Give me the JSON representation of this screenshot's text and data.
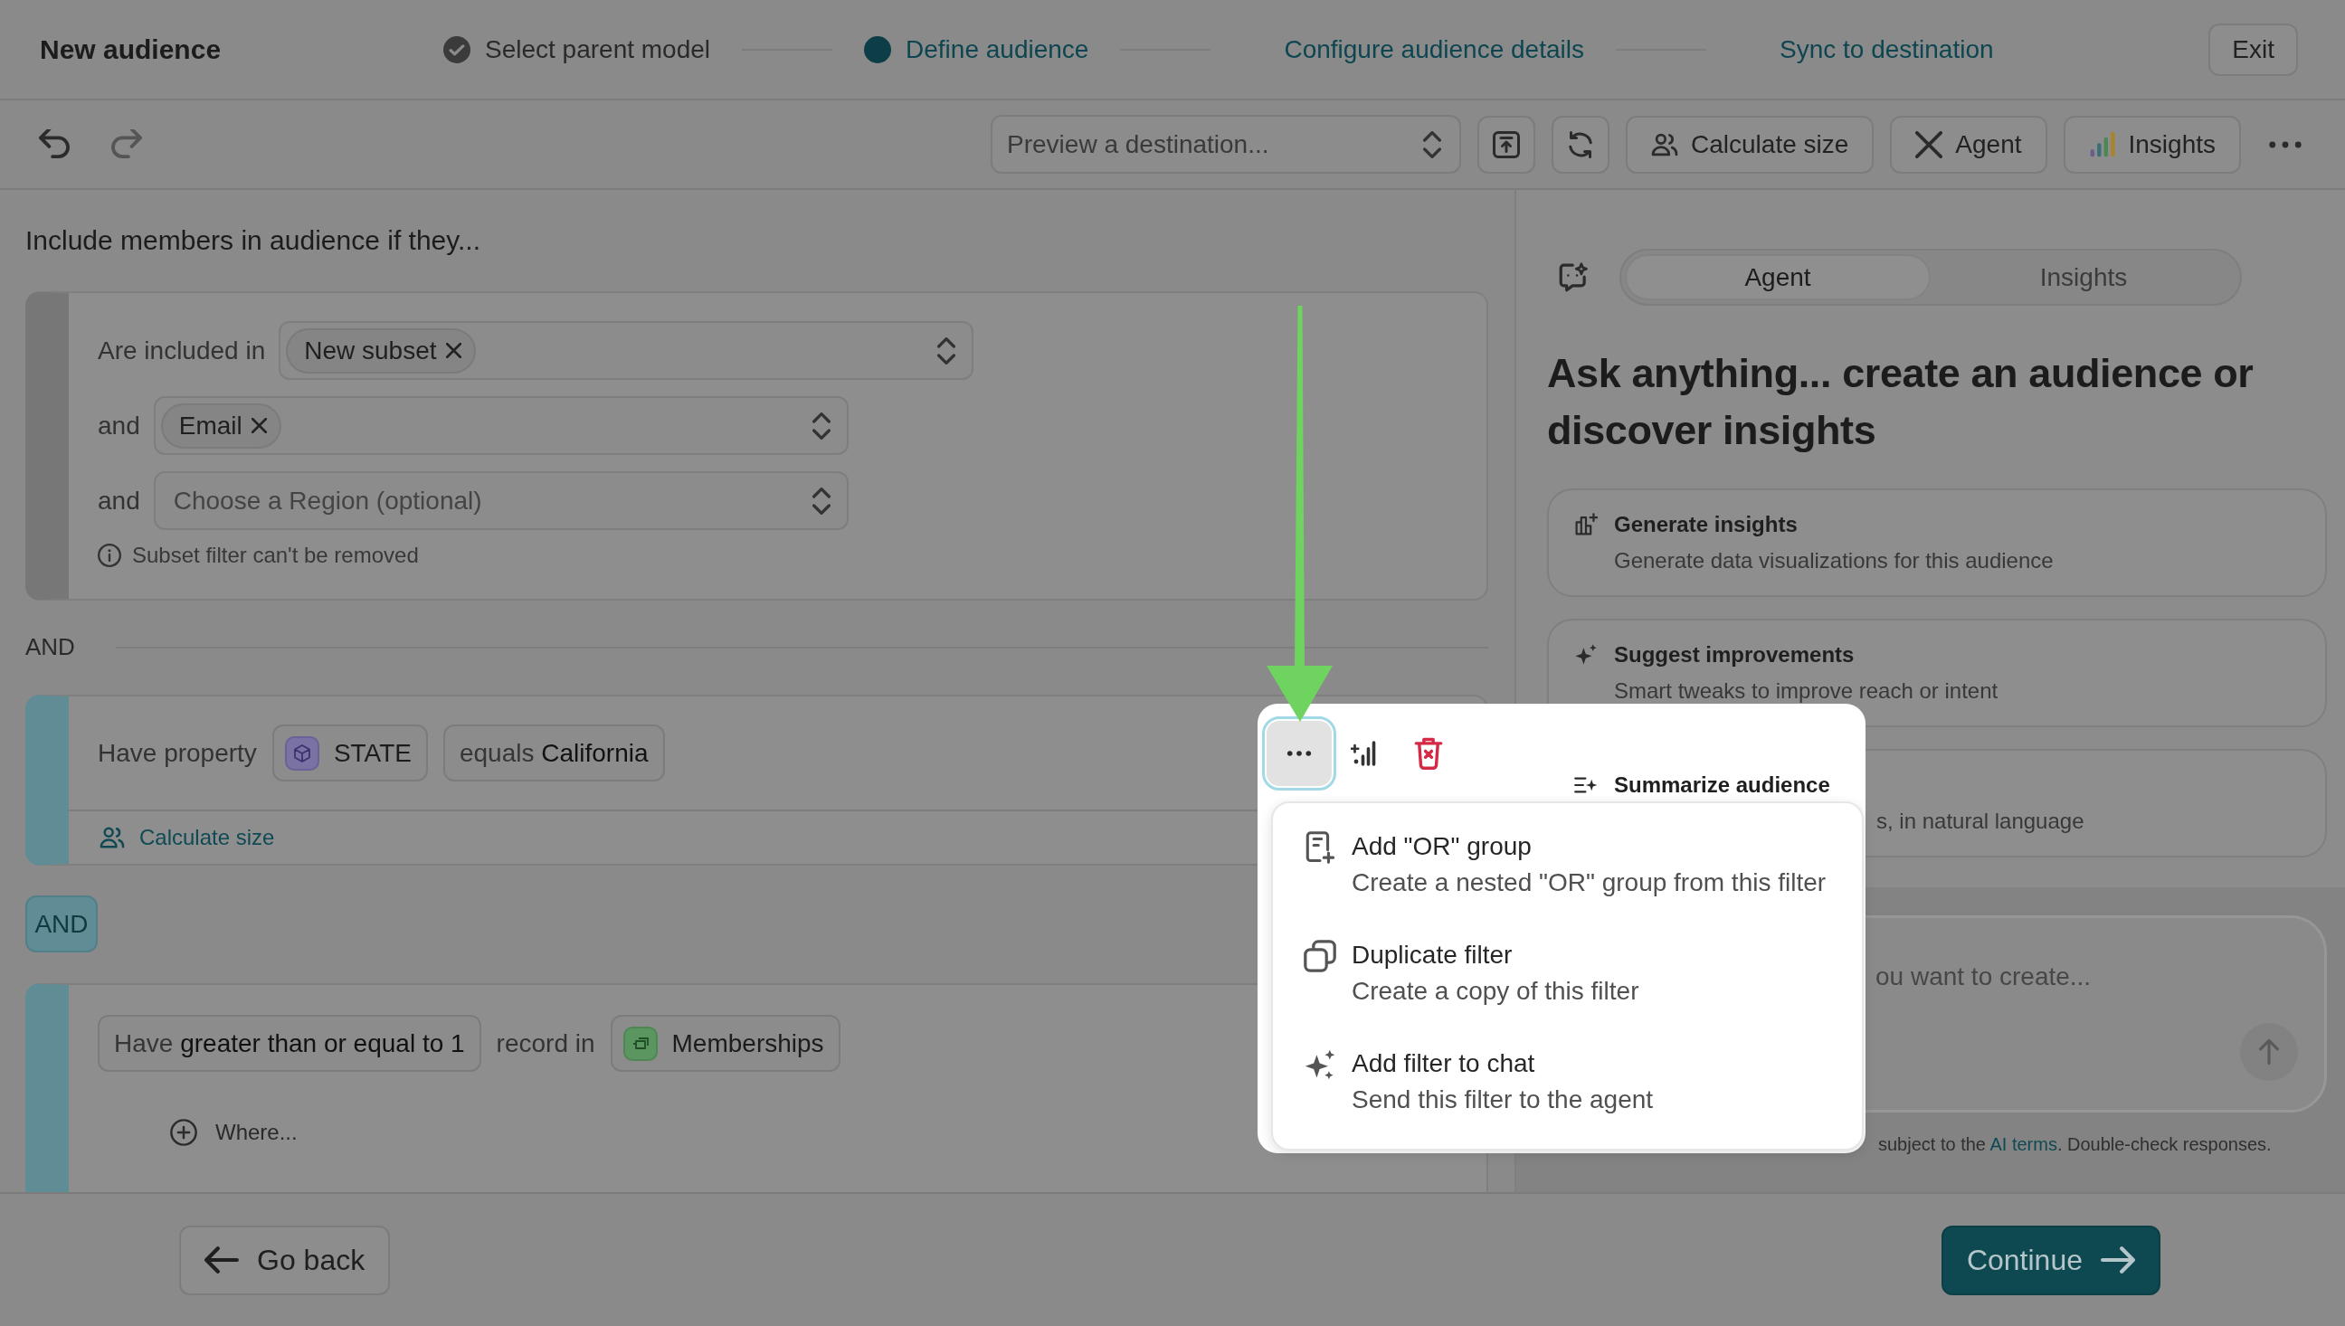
{
  "header": {
    "title": "New audience",
    "steps": [
      {
        "label": "Select parent model",
        "completed": true,
        "selected": false
      },
      {
        "label": "Define audience",
        "completed": false,
        "selected": true
      },
      {
        "label": "Configure audience details",
        "completed": false,
        "selected": false
      },
      {
        "label": "Sync to destination",
        "completed": false,
        "selected": false
      }
    ],
    "exit_button": "Exit"
  },
  "toolbar": {
    "destination_select": {
      "placeholder": "Preview a destination..."
    },
    "calculate_size_button": "Calculate size",
    "agent_button": "Agent",
    "insights_button": "Insights"
  },
  "audience_rules": {
    "heading": "Include members in audience if they...",
    "subset_filter": {
      "rows": [
        {
          "label": "Are included in",
          "chips": [
            "New subset"
          ]
        },
        {
          "label": "and",
          "chips": [
            "Email"
          ]
        },
        {
          "label": "and",
          "placeholder": "Choose a Region (optional)"
        }
      ],
      "note": "Subset filter can't be removed"
    },
    "and_divider": "AND",
    "property_filter": {
      "label": "Have property",
      "property": "STATE",
      "condition": "equals **California**",
      "calculate_size_link": "Calculate size"
    },
    "and_badge": "AND",
    "event_filter": {
      "condition": "Have **greater than or equal to 1**",
      "connector": "record in",
      "model": "Memberships",
      "where_button": "Where..."
    }
  },
  "filter_actions": {
    "expanded": true,
    "menu": [
      {
        "kind": "group",
        "title": "Add \"OR\" group",
        "description": "Create a nested \"OR\" group from this filter"
      },
      {
        "kind": "duplicate",
        "title": "Duplicate filter",
        "description": "Create a copy of this filter"
      },
      {
        "kind": "chat",
        "title": "Add filter to chat",
        "description": "Send this filter to the agent"
      }
    ]
  },
  "agent_panel": {
    "tabs": [
      {
        "label": "Agent",
        "selected": true
      },
      {
        "label": "Insights",
        "selected": false
      }
    ],
    "heading": "Ask anything... create an audience or discover insights",
    "suggestions": [
      {
        "kind": "insights",
        "title": "Generate insights",
        "description": "Generate data visualizations for this audience"
      },
      {
        "kind": "improve",
        "title": "Suggest improvements",
        "description": "Smart tweaks to improve reach or intent"
      },
      {
        "kind": "summarize",
        "title": "Summarize audience",
        "description": "s, in natural language"
      }
    ],
    "composer": {
      "placeholder": "ou want to create..."
    },
    "disclaimer": {
      "text": "subject to the",
      "link": "AI terms",
      "after": ". Double-check responses."
    }
  },
  "footer": {
    "back_button": "Go back",
    "continue_button": "Continue"
  }
}
